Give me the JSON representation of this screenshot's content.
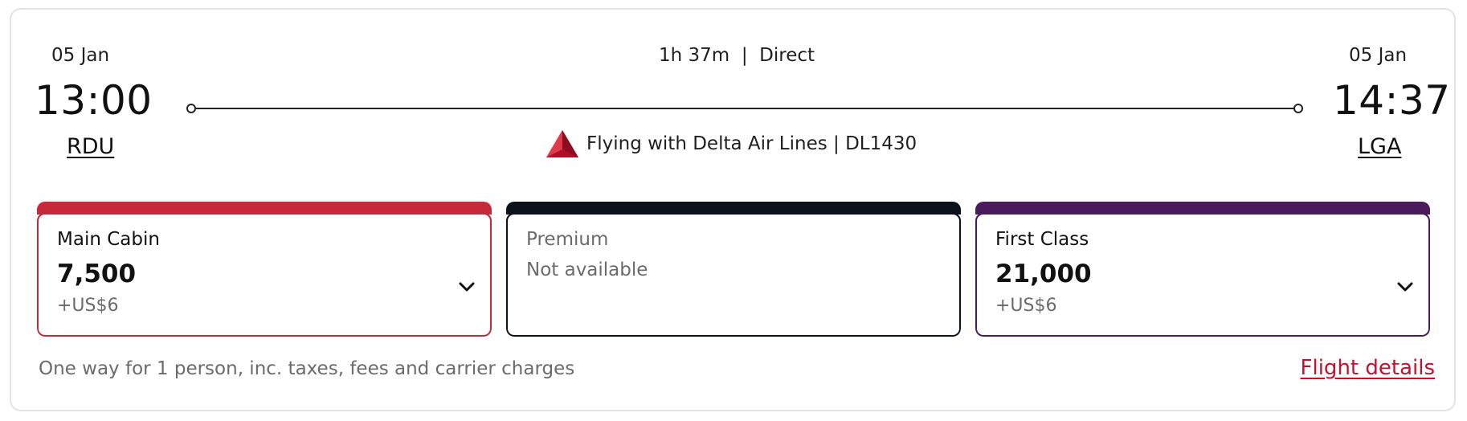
{
  "departure": {
    "date": "05 Jan",
    "time": "13:00",
    "airport": "RDU"
  },
  "arrival": {
    "date": "05 Jan",
    "time": "14:37",
    "airport": "LGA"
  },
  "flight": {
    "duration_stops": "1h 37m  |  Direct",
    "carrier_text": "Flying with Delta Air Lines | DL1430",
    "logo_icon": "delta-logo-icon"
  },
  "fares": [
    {
      "name": "Main Cabin",
      "points": "7,500",
      "fee": "+US$6",
      "color": "#c8293a"
    },
    {
      "name": "Premium",
      "status": "Not available",
      "color": "#0b1219"
    },
    {
      "name": "First Class",
      "points": "21,000",
      "fee": "+US$6",
      "color": "#4a1a5c"
    }
  ],
  "footer": {
    "note": "One way for 1 person, inc. taxes, fees and carrier charges",
    "details_link": "Flight details"
  },
  "colors": {
    "accent_red": "#c8102e",
    "muted_text": "#6b6b6b"
  }
}
